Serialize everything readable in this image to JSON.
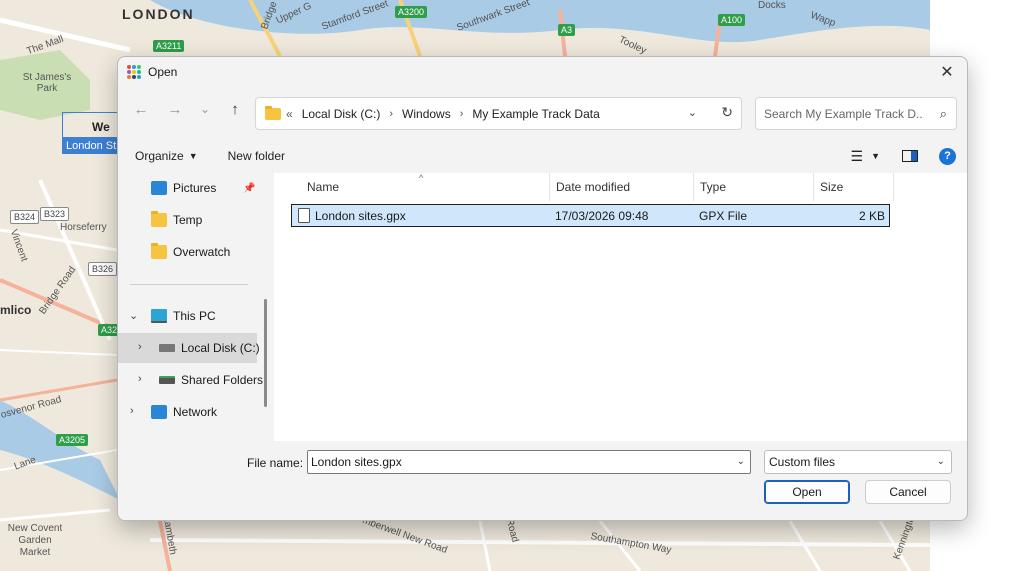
{
  "map": {
    "city_label": "LONDON",
    "labels": [
      "The Mall",
      "St James's Park",
      "Horseferry",
      "Vincent",
      "Bridge Road",
      "mlico",
      "osvenor Road",
      "Lane",
      "New Covent Garden Market",
      "Upper G",
      "Stamford Street",
      "Southwark Street",
      "Tooley",
      "Docks",
      "Wapp",
      "Bridge",
      "mberwell New Road",
      "Road",
      "Southampton Way",
      "Lambeth",
      "Kennington"
    ],
    "road_badges": [
      "A3211",
      "A3200",
      "A3",
      "A100",
      "B324",
      "B323",
      "B326",
      "A32",
      "A3205"
    ],
    "selected_point_label": "We",
    "selected_point_name": "London St"
  },
  "dialog": {
    "title": "Open",
    "close_icon": "✕",
    "nav": {
      "back": "←",
      "forward": "→",
      "recent": "⌄",
      "up": "↑"
    },
    "breadcrumb": {
      "overflow": "«",
      "items": [
        "Local Disk (C:)",
        "Windows",
        "My Example Track Data"
      ],
      "separator": "›"
    },
    "search": {
      "placeholder": "Search My Example Track D...",
      "value": ""
    },
    "toolbar": {
      "organize_label": "Organize",
      "new_folder_label": "New folder"
    },
    "nav_pane": {
      "items": [
        {
          "label": "Pictures",
          "icon": "pictures-icon",
          "pinned": true
        },
        {
          "label": "Temp",
          "icon": "folder-icon"
        },
        {
          "label": "Overwatch",
          "icon": "folder-icon"
        },
        {
          "label": "This PC",
          "icon": "pc-icon",
          "expanded": true
        },
        {
          "label": "Local Disk (C:)",
          "icon": "disk-icon",
          "selected": true
        },
        {
          "label": "Shared Folders",
          "icon": "shared-folder-icon"
        },
        {
          "label": "Network",
          "icon": "network-icon"
        }
      ]
    },
    "file_list": {
      "columns": [
        "Name",
        "Date modified",
        "Type",
        "Size"
      ],
      "rows": [
        {
          "name": "London sites.gpx",
          "date": "17/03/2026 09:48",
          "type": "GPX File",
          "size": "2 KB",
          "selected": true
        }
      ]
    },
    "footer": {
      "file_name_label": "File name:",
      "file_name_value": "London sites.gpx",
      "file_type_value": "Custom files",
      "open_label": "Open",
      "cancel_label": "Cancel"
    },
    "colors": {
      "accent": "#1b5fbf",
      "selection": "#cfe6fb",
      "folder": "#f5c542"
    }
  }
}
